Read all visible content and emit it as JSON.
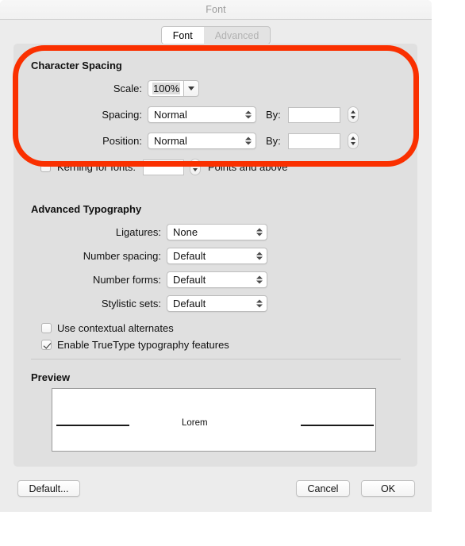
{
  "window": {
    "title": "Font"
  },
  "tabs": [
    {
      "label": "Font",
      "state": "selected"
    },
    {
      "label": "Advanced",
      "state": "disabled"
    }
  ],
  "character_spacing": {
    "heading": "Character Spacing",
    "scale": {
      "label": "Scale:",
      "value": "100%"
    },
    "spacing": {
      "label": "Spacing:",
      "value": "Normal",
      "by_label": "By:",
      "by_value": ""
    },
    "position": {
      "label": "Position:",
      "value": "Normal",
      "by_label": "By:",
      "by_value": ""
    },
    "kerning": {
      "label": "Kerning for fonts:",
      "value": "",
      "suffix": "Points and above",
      "checked": false
    }
  },
  "advanced_typography": {
    "heading": "Advanced Typography",
    "rows": [
      {
        "label": "Ligatures:",
        "value": "None"
      },
      {
        "label": "Number spacing:",
        "value": "Default"
      },
      {
        "label": "Number forms:",
        "value": "Default"
      },
      {
        "label": "Stylistic sets:",
        "value": "Default"
      }
    ],
    "checkboxes": [
      {
        "label": "Use contextual alternates",
        "checked": false
      },
      {
        "label": "Enable TrueType typography features",
        "checked": true
      }
    ]
  },
  "preview": {
    "heading": "Preview",
    "sample_text": "Lorem"
  },
  "buttons": {
    "default": "Default...",
    "cancel": "Cancel",
    "ok": "OK"
  },
  "annotation": {
    "color": "#fa3000",
    "shape": "rounded-rectangle-highlight",
    "target": "Character Spacing"
  }
}
